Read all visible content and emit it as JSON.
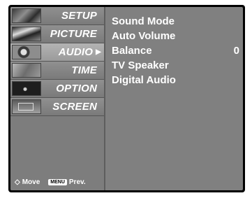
{
  "sidebar": {
    "items": [
      {
        "label": "SETUP",
        "icon": "setup-icon",
        "active": false
      },
      {
        "label": "PICTURE",
        "icon": "picture-icon",
        "active": false
      },
      {
        "label": "AUDIO",
        "icon": "audio-icon",
        "active": true
      },
      {
        "label": "TIME",
        "icon": "time-icon",
        "active": false
      },
      {
        "label": "OPTION",
        "icon": "option-icon",
        "active": false
      },
      {
        "label": "SCREEN",
        "icon": "screen-icon",
        "active": false
      }
    ],
    "active_arrow": "▶"
  },
  "audio_menu": {
    "items": [
      {
        "label": "Sound Mode",
        "value": ""
      },
      {
        "label": "Auto Volume",
        "value": ""
      },
      {
        "label": "Balance",
        "value": "0"
      },
      {
        "label": "TV Speaker",
        "value": ""
      },
      {
        "label": "Digital Audio",
        "value": ""
      }
    ]
  },
  "footer": {
    "move_icon": "◇",
    "move_label": "Move",
    "menu_key": "MENU",
    "prev_label": "Prev."
  },
  "colors": {
    "panel": "#808080",
    "active_item": "#b3b3b3",
    "text": "#ffffff"
  }
}
